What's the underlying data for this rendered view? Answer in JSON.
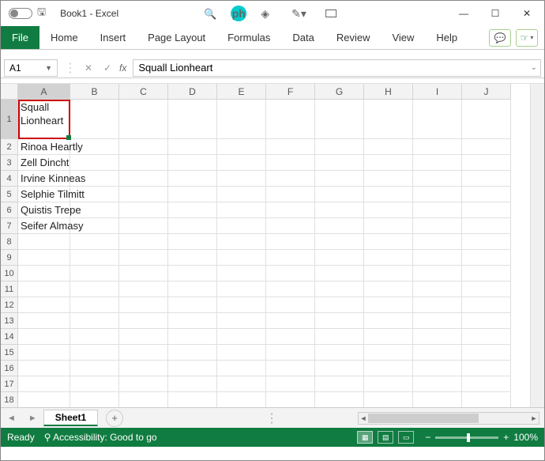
{
  "title": "Book1  -  Excel",
  "ribbon": {
    "file": "File",
    "tabs": [
      "Home",
      "Insert",
      "Page Layout",
      "Formulas",
      "Data",
      "Review",
      "View",
      "Help"
    ]
  },
  "namebox": "A1",
  "formula": "Squall Lionheart",
  "columns": [
    "A",
    "B",
    "C",
    "D",
    "E",
    "F",
    "G",
    "H",
    "I",
    "J"
  ],
  "rows": [
    "1",
    "2",
    "3",
    "4",
    "5",
    "6",
    "7",
    "8",
    "9",
    "10",
    "11",
    "12",
    "13",
    "14",
    "15",
    "16",
    "17",
    "18"
  ],
  "cells": {
    "A1": "Squall Lionheart",
    "A2": "Rinoa Heartly",
    "A3": "Zell Dincht",
    "A4": "Irvine Kinneas",
    "A5": "Selphie Tilmitt",
    "A6": "Quistis Trepe",
    "A7": "Seifer Almasy"
  },
  "sheet": "Sheet1",
  "status": {
    "ready": "Ready",
    "accessibility": "Accessibility: Good to go",
    "zoom": "100%"
  }
}
